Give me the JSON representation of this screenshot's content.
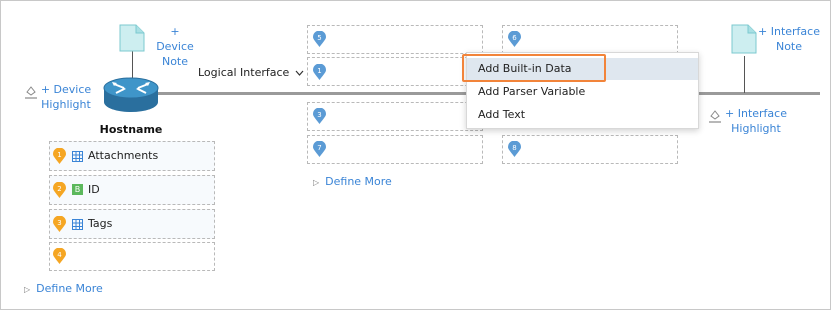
{
  "device": {
    "note_link": [
      "+ Device",
      "Note"
    ],
    "highlight_link": [
      "+ Device",
      "Highlight"
    ],
    "hostname": "Hostname",
    "data_slots": [
      {
        "num": "1",
        "icon": "grid-icon",
        "label": "Attachments"
      },
      {
        "num": "2",
        "icon": "b-badge-icon",
        "label": "ID"
      },
      {
        "num": "3",
        "icon": "grid-icon",
        "label": "Tags"
      },
      {
        "num": "4",
        "icon": "",
        "label": ""
      }
    ],
    "define_more": "Define More"
  },
  "interface": {
    "logical_label": "Logical Interface",
    "note_link": [
      "+ Interface",
      "Note"
    ],
    "highlight_link": [
      "+ Interface",
      "Highlight"
    ],
    "slot_numbers": [
      "5",
      "6",
      "1",
      "3",
      "7",
      "8"
    ],
    "define_more": "Define More"
  },
  "context_menu": {
    "items": [
      "Add Built-in Data",
      "Add Parser Variable",
      "Add Text"
    ],
    "highlighted_index": 0
  },
  "colors": {
    "link": "#3a84d6",
    "orange_pin": "#f5a623",
    "blue_pin": "#5b9bd5",
    "menu_highlight": "#dfe7ef",
    "highlight_border": "#f2843a",
    "note_icon": "#cdeef0"
  }
}
